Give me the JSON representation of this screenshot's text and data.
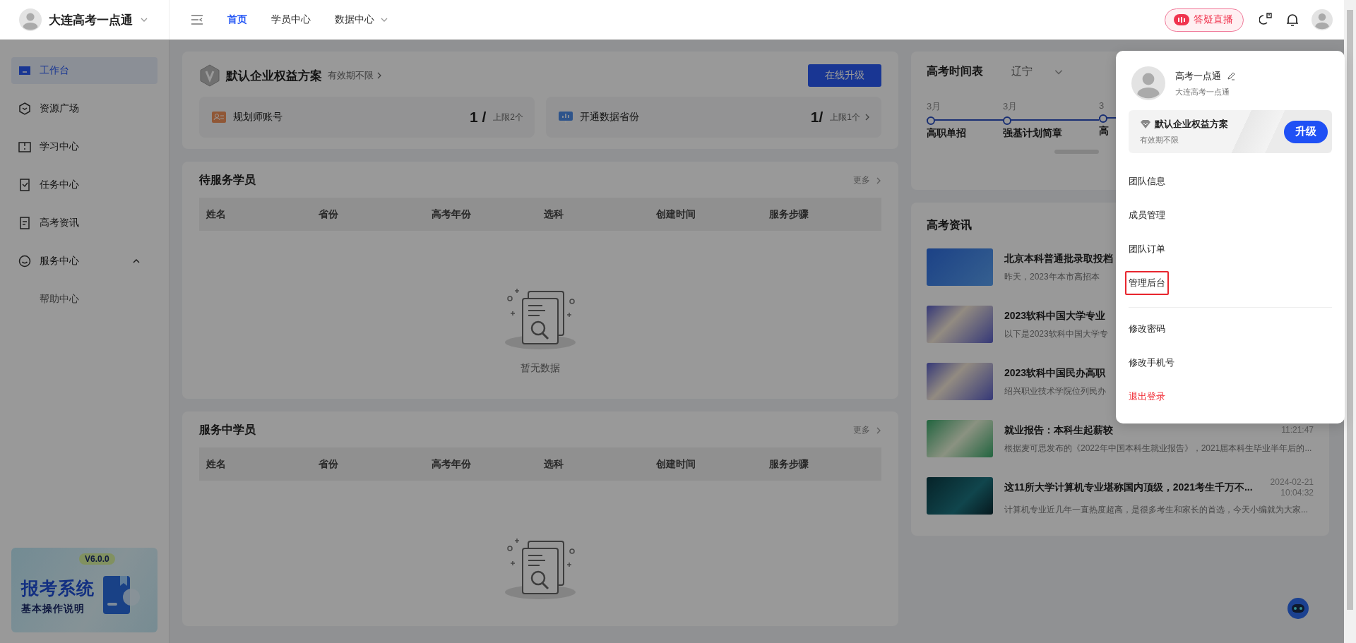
{
  "header": {
    "brand": "大连高考一点通",
    "nav": [
      {
        "label": "首页",
        "selected": true,
        "has_dropdown": false
      },
      {
        "label": "学员中心",
        "selected": false,
        "has_dropdown": false
      },
      {
        "label": "数据中心",
        "selected": false,
        "has_dropdown": true
      }
    ],
    "live_button": "答疑直播"
  },
  "sidebar": {
    "items": [
      {
        "label": "工作台",
        "selected": true
      },
      {
        "label": "资源广场",
        "selected": false
      },
      {
        "label": "学习中心",
        "selected": false
      },
      {
        "label": "任务中心",
        "selected": false
      },
      {
        "label": "高考资讯",
        "selected": false
      },
      {
        "label": "服务中心",
        "selected": false,
        "expanded": true,
        "children": [
          {
            "label": "帮助中心",
            "selected": false
          }
        ]
      }
    ],
    "banner": {
      "version": "V6.0.0",
      "title": "报考系统",
      "subtitle": "基本操作说明"
    }
  },
  "plan": {
    "title": "默认企业权益方案",
    "validity": "有效期不限",
    "upgrade_button": "在线升级",
    "quotas": [
      {
        "label": "规划师账号",
        "count": "1 /",
        "limit": "上限2个",
        "has_link": false
      },
      {
        "label": "开通数据省份",
        "count": "1/",
        "limit": "上限1个",
        "has_link": true
      }
    ]
  },
  "pending_students": {
    "title": "待服务学员",
    "more": "更多",
    "columns": [
      "姓名",
      "省份",
      "高考年份",
      "选科",
      "创建时间",
      "服务步骤"
    ],
    "empty_text": "暂无数据"
  },
  "serving_students": {
    "title": "服务中学员",
    "more": "更多",
    "columns": [
      "姓名",
      "省份",
      "高考年份",
      "选科",
      "创建时间",
      "服务步骤"
    ]
  },
  "schedule": {
    "title": "高考时间表",
    "region": "辽宁",
    "events": [
      {
        "month": "3月",
        "label": "高职单招"
      },
      {
        "month": "3月",
        "label": "强基计划简章"
      },
      {
        "month": "3",
        "label": "高"
      }
    ]
  },
  "news": {
    "title": "高考资讯",
    "items": [
      {
        "title": "北京本科普通批录取投档",
        "summary": "昨天，2023年本市高招本"
      },
      {
        "title": "2023软科中国大学专业",
        "summary": "以下是2023软科中国大学专"
      },
      {
        "title": "2023软科中国民办高职",
        "summary": "绍兴职业技术学院位列民办"
      },
      {
        "title": "就业报告：本科生起薪较",
        "summary": "根据麦可思发布的《2022年中国本科生就业报告》，2021届本科生毕业半年后的...",
        "time": "11:21:47"
      },
      {
        "title": "这11所大学计算机专业堪称国内顶级，2021考生千万不...",
        "summary": "计算机专业近几年一直热度超高，是很多考生和家长的首选，今天小编就为大家...",
        "date": "2024-02-21",
        "time": "10:04:32"
      }
    ]
  },
  "user_menu": {
    "name": "高考一点通",
    "org": "大连高考一点通",
    "plan": {
      "title": "默认企业权益方案",
      "validity": "有效期不限",
      "button": "升级"
    },
    "sections": [
      {
        "items": [
          {
            "label": "团队信息",
            "kind": "normal",
            "outlined": false
          },
          {
            "label": "成员管理",
            "kind": "normal",
            "outlined": false
          },
          {
            "label": "团队订单",
            "kind": "normal",
            "outlined": false
          },
          {
            "label": "管理后台",
            "kind": "normal",
            "outlined": true
          }
        ]
      },
      {
        "items": [
          {
            "label": "修改密码",
            "kind": "normal",
            "outlined": false
          },
          {
            "label": "修改手机号",
            "kind": "normal",
            "outlined": false
          },
          {
            "label": "退出登录",
            "kind": "danger",
            "outlined": false
          }
        ]
      }
    ]
  }
}
